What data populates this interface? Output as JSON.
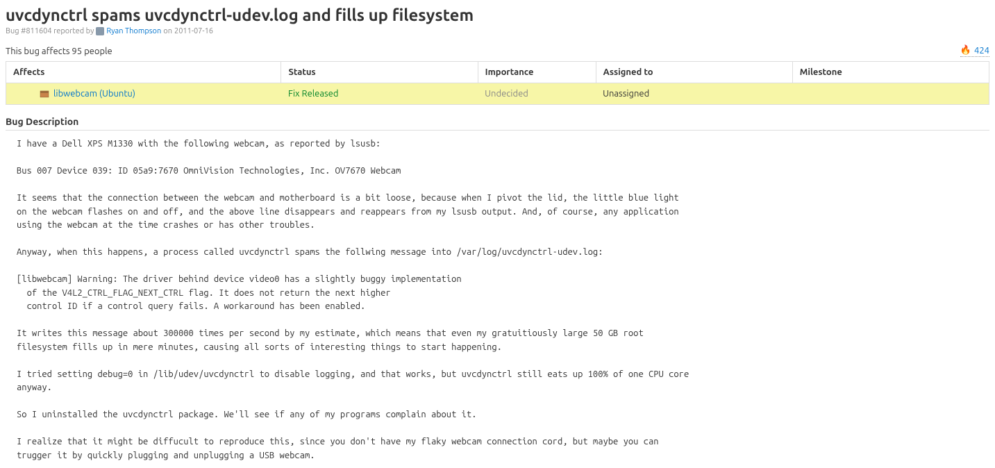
{
  "header": {
    "title": "uvcdynctrl spams uvcdynctrl-udev.log and fills up filesystem",
    "bug_prefix": "Bug #811604 reported by",
    "reporter": "Ryan Thompson",
    "date_prefix": "on",
    "date": "2011-07-16"
  },
  "affects_bar": {
    "text": "This bug affects 95 people",
    "heat": "424"
  },
  "table": {
    "headers": {
      "affects": "Affects",
      "status": "Status",
      "importance": "Importance",
      "assigned_to": "Assigned to",
      "milestone": "Milestone"
    },
    "row": {
      "affects": "libwebcam (Ubuntu)",
      "status": "Fix Released",
      "importance": "Undecided",
      "assigned_to": "Unassigned",
      "milestone": ""
    }
  },
  "description": {
    "header": "Bug Description",
    "body": "I have a Dell XPS M1330 with the following webcam, as reported by lsusb:\n\nBus 007 Device 039: ID 05a9:7670 OmniVision Technologies, Inc. OV7670 Webcam\n\nIt seems that the connection between the webcam and motherboard is a bit loose, because when I pivot the lid, the little blue light\non the webcam flashes on and off, and the above line disappears and reappears from my lsusb output. And, of course, any application\nusing the webcam at the time crashes or has other troubles.\n\nAnyway, when this happens, a process called uvcdynctrl spams the follwing message into /var/log/uvcdynctrl-udev.log:\n\n[libwebcam] Warning: The driver behind device video0 has a slightly buggy implementation\n  of the V4L2_CTRL_FLAG_NEXT_CTRL flag. It does not return the next higher\n  control ID if a control query fails. A workaround has been enabled.\n\nIt writes this message about 300000 times per second by my estimate, which means that even my gratuitiously large 50 GB root\nfilesystem fills up in mere minutes, causing all sorts of interesting things to start happening.\n\nI tried setting debug=0 in /lib/udev/uvcdynctrl to disable logging, and that works, but uvcdynctrl still eats up 100% of one CPU core\nanyway.\n\nSo I uninstalled the uvcdynctrl package. We'll see if any of my programs complain about it.\n\nI realize that it might be diffucult to reproduce this, since you don't have my flaky webcam connection cord, but maybe you can\ntrugger it by quickly plugging and unplugging a USB webcam."
  }
}
